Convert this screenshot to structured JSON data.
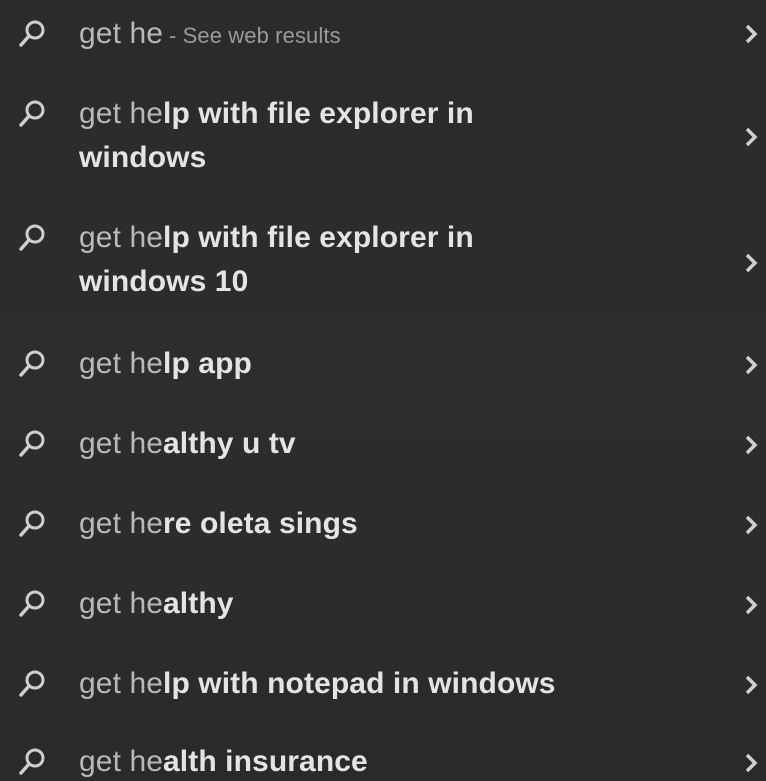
{
  "results": [
    {
      "prefix": "get he",
      "suffix": "",
      "hint": "- See web results",
      "line2": ""
    },
    {
      "prefix": "get he",
      "suffix": "lp with file explorer in",
      "hint": "",
      "line2": "windows"
    },
    {
      "prefix": "get he",
      "suffix": "lp with file explorer in",
      "hint": "",
      "line2": "windows 10"
    },
    {
      "prefix": "get he",
      "suffix": "lp app",
      "hint": "",
      "line2": ""
    },
    {
      "prefix": "get he",
      "suffix": "althy u tv",
      "hint": "",
      "line2": ""
    },
    {
      "prefix": "get he",
      "suffix": "re oleta sings",
      "hint": "",
      "line2": ""
    },
    {
      "prefix": "get he",
      "suffix": "althy",
      "hint": "",
      "line2": ""
    },
    {
      "prefix": "get he",
      "suffix": "lp with notepad in windows",
      "hint": "",
      "line2": ""
    },
    {
      "prefix": "get he",
      "suffix": "alth insurance",
      "hint": "",
      "line2": ""
    }
  ],
  "icons": {
    "search": "search-icon",
    "chevron": "chevron-right-icon"
  },
  "colors": {
    "background": "#2b2b2b",
    "text_primary": "#e4e4e4",
    "text_secondary": "#b9b9b9"
  }
}
